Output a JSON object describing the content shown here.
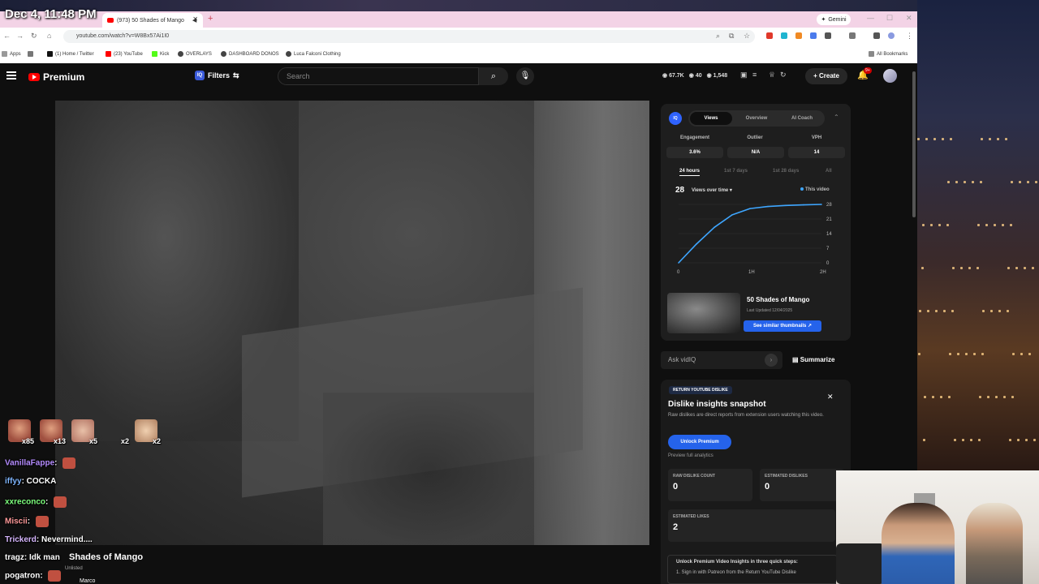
{
  "overlay": {
    "clock": "Dec 4, 11:48 PM"
  },
  "browser": {
    "tab_title": "(973) 50 Shades of Mango",
    "url": "youtube.com/watch?v=W8Bx57Ai1I0",
    "gemini_label": "Gemini",
    "all_bookmarks": "All Bookmarks",
    "bookmarks": [
      {
        "label": "Apps"
      },
      {
        "label": "(1) Home / Twitter"
      },
      {
        "label": "(23) YouTube"
      },
      {
        "label": "Kick"
      },
      {
        "label": "OVERLAYS"
      },
      {
        "label": "DASHBOARD DONOS"
      },
      {
        "label": "Luca Falconi Clothing"
      }
    ]
  },
  "youtube": {
    "logo_text": "Premium",
    "filters_label": "Filters",
    "search_placeholder": "Search",
    "stats": {
      "views": "67.7K",
      "likes": "40",
      "subs": "1,548"
    },
    "create_label": "Create",
    "notif_badge": "9+",
    "video": {
      "title": "Shades of Mango",
      "visibility": "Unlisted",
      "channel": "Marco"
    }
  },
  "chat": {
    "emote_counts": [
      "x85",
      "x13",
      "x5",
      "x2",
      "x2"
    ],
    "messages": [
      {
        "user": "VanillaFappe",
        "color": "#b58cff",
        "text": ""
      },
      {
        "user": "iffyy",
        "color": "#7fb6ff",
        "text": "COCKA"
      },
      {
        "user": "xxreconco",
        "color": "#7dff7d",
        "text": ""
      },
      {
        "user": "Miscii",
        "color": "#ff9a9a",
        "text": ""
      },
      {
        "user": "Trickerd",
        "color": "#d7b7ff",
        "text": "Nevermind...."
      },
      {
        "user": "tragz",
        "color": "#ffffff",
        "text": "Idk man"
      },
      {
        "user": "pogatron",
        "color": "#ffffff",
        "text": ""
      }
    ]
  },
  "vidiq": {
    "logo": "IQ",
    "tabs": [
      "Views",
      "Overview",
      "AI Coach"
    ],
    "metrics": [
      {
        "label": "Engagement",
        "value": "3.6%"
      },
      {
        "label": "Outlier",
        "value": "N/A"
      },
      {
        "label": "VPH",
        "value": "14"
      }
    ],
    "ranges": [
      "24 hours",
      "1st 7 days",
      "1st 28 days",
      "All"
    ],
    "views_count": "28",
    "views_dropdown": "Views over time",
    "legend": "This video",
    "card_title": "50 Shades of Mango",
    "card_updated": "Last Updated 12/04/2025",
    "similar_button": "See similar thumbnails",
    "ask_placeholder": "Ask vidIQ",
    "summarize": "Summarize"
  },
  "ryd": {
    "tag": "RETURN YOUTUBE DISLIKE",
    "title": "Dislike insights snapshot",
    "desc": "Raw dislikes are direct reports from extension users watching this video.",
    "unlock": "Unlock Premium",
    "preview": "Preview full analytics",
    "stats": [
      {
        "label": "RAW DISLIKE COUNT",
        "value": "0"
      },
      {
        "label": "ESTIMATED DISLIKES",
        "value": "0"
      },
      {
        "label": "ESTIMATED LIKES",
        "value": "2"
      }
    ],
    "steps_title": "Unlock Premium Video Insights in three quick steps:",
    "step1": "1.  Sign in with Patreon from the Return YouTube Dislike"
  },
  "chart_data": {
    "type": "line",
    "x": [
      0,
      0.25,
      0.5,
      0.75,
      1,
      1.25,
      1.5,
      1.75,
      2
    ],
    "x_tick_labels": [
      "0",
      "1H",
      "2H"
    ],
    "series": [
      {
        "name": "This video",
        "values": [
          0,
          9,
          17,
          23,
          26,
          27,
          27.5,
          27.8,
          28
        ]
      }
    ],
    "yticks": [
      "28",
      "21",
      "14",
      "7",
      "0"
    ],
    "ylim": [
      0,
      28
    ],
    "xlim": [
      0,
      2
    ],
    "color": "#3ea6ff"
  }
}
